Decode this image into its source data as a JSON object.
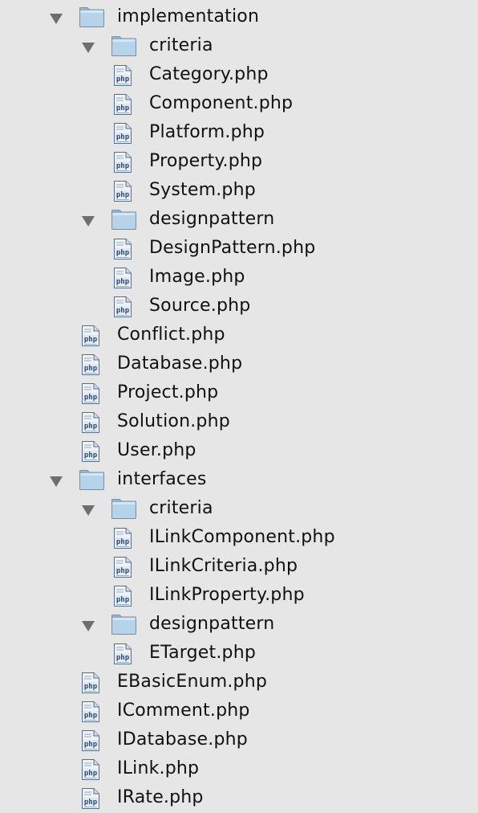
{
  "tree": [
    {
      "type": "folder",
      "depth": 0,
      "expanded": true,
      "label": "implementation",
      "icon": "folder-icon"
    },
    {
      "type": "folder",
      "depth": 1,
      "expanded": true,
      "label": "criteria",
      "icon": "folder-icon"
    },
    {
      "type": "file",
      "depth": 2,
      "label": "Category.php",
      "icon": "php-file-icon"
    },
    {
      "type": "file",
      "depth": 2,
      "label": "Component.php",
      "icon": "php-file-icon"
    },
    {
      "type": "file",
      "depth": 2,
      "label": "Platform.php",
      "icon": "php-file-icon"
    },
    {
      "type": "file",
      "depth": 2,
      "label": "Property.php",
      "icon": "php-file-icon"
    },
    {
      "type": "file",
      "depth": 2,
      "label": "System.php",
      "icon": "php-file-icon"
    },
    {
      "type": "folder",
      "depth": 1,
      "expanded": true,
      "label": "designpattern",
      "icon": "folder-icon"
    },
    {
      "type": "file",
      "depth": 2,
      "label": "DesignPattern.php",
      "icon": "php-file-icon"
    },
    {
      "type": "file",
      "depth": 2,
      "label": "Image.php",
      "icon": "php-file-icon"
    },
    {
      "type": "file",
      "depth": 2,
      "label": "Source.php",
      "icon": "php-file-icon"
    },
    {
      "type": "file",
      "depth": 1,
      "label": "Conflict.php",
      "icon": "php-file-icon"
    },
    {
      "type": "file",
      "depth": 1,
      "label": "Database.php",
      "icon": "php-file-icon"
    },
    {
      "type": "file",
      "depth": 1,
      "label": "Project.php",
      "icon": "php-file-icon"
    },
    {
      "type": "file",
      "depth": 1,
      "label": "Solution.php",
      "icon": "php-file-icon"
    },
    {
      "type": "file",
      "depth": 1,
      "label": "User.php",
      "icon": "php-file-icon"
    },
    {
      "type": "folder",
      "depth": 0,
      "expanded": true,
      "label": "interfaces",
      "icon": "folder-icon"
    },
    {
      "type": "folder",
      "depth": 1,
      "expanded": true,
      "label": "criteria",
      "icon": "folder-icon"
    },
    {
      "type": "file",
      "depth": 2,
      "label": "ILinkComponent.php",
      "icon": "php-file-icon"
    },
    {
      "type": "file",
      "depth": 2,
      "label": "ILinkCriteria.php",
      "icon": "php-file-icon"
    },
    {
      "type": "file",
      "depth": 2,
      "label": "ILinkProperty.php",
      "icon": "php-file-icon"
    },
    {
      "type": "folder",
      "depth": 1,
      "expanded": true,
      "label": "designpattern",
      "icon": "folder-icon"
    },
    {
      "type": "file",
      "depth": 2,
      "label": "ETarget.php",
      "icon": "php-file-icon"
    },
    {
      "type": "file",
      "depth": 1,
      "label": "EBasicEnum.php",
      "icon": "php-file-icon"
    },
    {
      "type": "file",
      "depth": 1,
      "label": "IComment.php",
      "icon": "php-file-icon"
    },
    {
      "type": "file",
      "depth": 1,
      "label": "IDatabase.php",
      "icon": "php-file-icon"
    },
    {
      "type": "file",
      "depth": 1,
      "label": "ILink.php",
      "icon": "php-file-icon"
    },
    {
      "type": "file",
      "depth": 1,
      "label": "IRate.php",
      "icon": "php-file-icon"
    }
  ],
  "colors": {
    "background": "#e6e6e6",
    "folder_fill": "#b7d3ea",
    "folder_stroke": "#6f8fae",
    "disclosure": "#6e6e6e",
    "php_icon_fill": "#eef3f8",
    "php_icon_stroke": "#5a6e88"
  }
}
